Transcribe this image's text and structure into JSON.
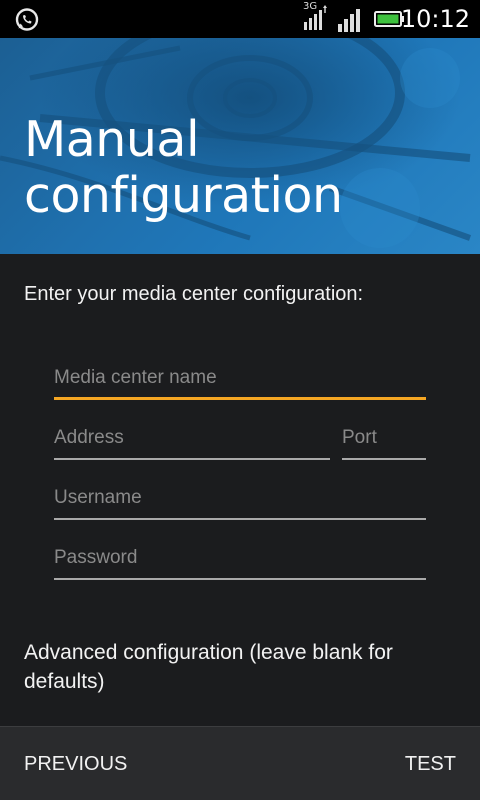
{
  "status_bar": {
    "network_type": "3G",
    "time": "10:12",
    "icons": [
      "whatsapp-icon",
      "signal-3g-icon",
      "signal-icon",
      "battery-icon"
    ],
    "battery_color": "#3ec13e"
  },
  "header": {
    "title": "Manual configuration",
    "background_color": "#1f70ae"
  },
  "form": {
    "intro": "Enter your media center configuration:",
    "media_center_name": {
      "placeholder": "Media center name",
      "value": ""
    },
    "address": {
      "placeholder": "Address",
      "value": ""
    },
    "port": {
      "placeholder": "Port",
      "value": ""
    },
    "username": {
      "placeholder": "Username",
      "value": ""
    },
    "password": {
      "placeholder": "Password",
      "value": ""
    },
    "focus_color": "#f5a623",
    "advanced_label": "Advanced configuration (leave blank for defaults)"
  },
  "footer": {
    "previous_label": "PREVIOUS",
    "test_label": "TEST"
  }
}
